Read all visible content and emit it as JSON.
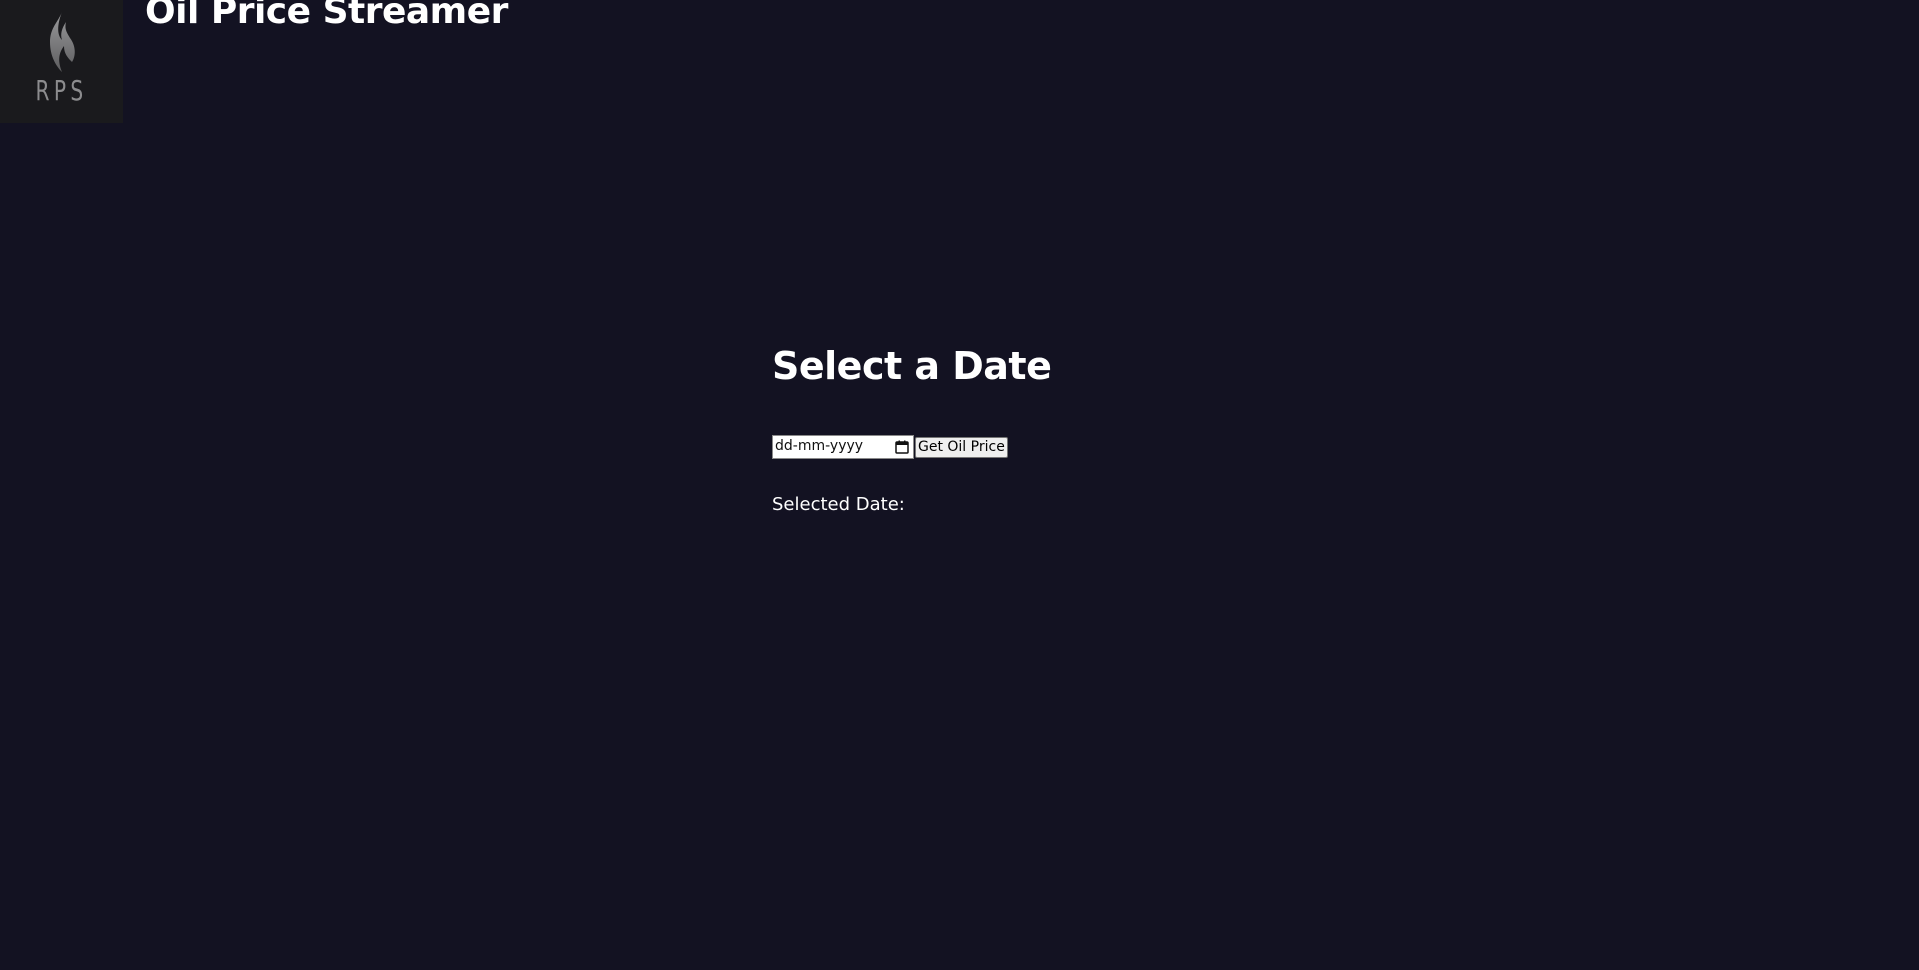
{
  "header": {
    "logo_text": "RPS",
    "title": "Oil Price Streamer"
  },
  "main": {
    "heading": "Select a Date",
    "date_input": {
      "placeholder": "dd-mm-yyyy",
      "value": ""
    },
    "submit_button_label": "Get Oil Price",
    "selected_date_label": "Selected Date:",
    "selected_date_value": ""
  },
  "icons": {
    "logo": "flame-icon",
    "date_picker": "calendar-icon"
  },
  "colors": {
    "background": "#131222",
    "logo_background": "#1a1a1d",
    "logo_gray": "#8c8c8e",
    "text": "#ffffff"
  }
}
